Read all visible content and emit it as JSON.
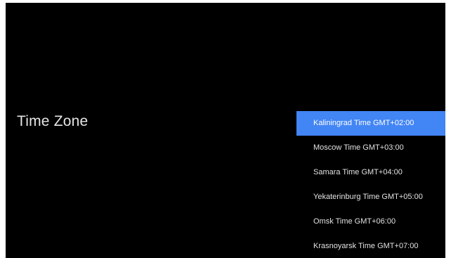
{
  "page": {
    "title": "Time Zone"
  },
  "time_zones": {
    "selected_index": 0,
    "highlight_color": "#4285f4",
    "items": [
      {
        "label": "Kaliningrad Time GMT+02:00"
      },
      {
        "label": "Moscow Time GMT+03:00"
      },
      {
        "label": "Samara Time GMT+04:00"
      },
      {
        "label": "Yekaterinburg Time GMT+05:00"
      },
      {
        "label": "Omsk Time GMT+06:00"
      },
      {
        "label": "Krasnoyarsk Time GMT+07:00"
      }
    ]
  }
}
